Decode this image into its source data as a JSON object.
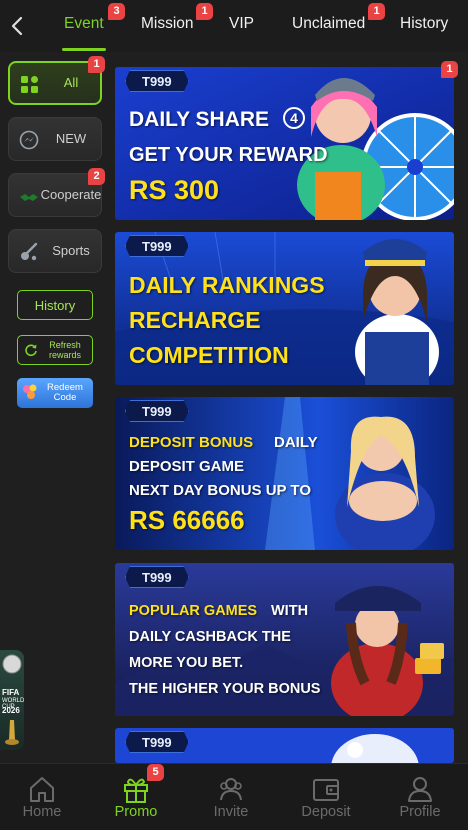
{
  "header": {
    "tabs": [
      {
        "label": "Event",
        "badge": "3"
      },
      {
        "label": "Mission",
        "badge": "1"
      },
      {
        "label": "VIP",
        "badge": ""
      },
      {
        "label": "Unclaimed",
        "badge": "1"
      },
      {
        "label": "History",
        "badge": ""
      }
    ]
  },
  "sidebar": {
    "categories": [
      {
        "label": "All",
        "badge": "1",
        "icon": "grid-icon"
      },
      {
        "label": "NEW",
        "badge": "",
        "icon": "messenger-icon"
      },
      {
        "label": "Cooperate",
        "badge": "2",
        "icon": "handshake-icon"
      },
      {
        "label": "Sports",
        "badge": "",
        "icon": "sports-icon"
      }
    ],
    "history_label": "History",
    "refresh_label": "Refresh rewards",
    "redeem_label": "Redeem Code"
  },
  "fifa": {
    "line1": "FIFA",
    "line2": "WORLD CUP",
    "line3": "2026"
  },
  "banners": [
    {
      "tag": "T999",
      "badge": "1",
      "lines": [
        "DAILY SHARE",
        "4",
        "GET YOUR REWARD",
        "RS 300"
      ]
    },
    {
      "tag": "T999",
      "lines": [
        "DAILY RANKINGS",
        "RECHARGE",
        "COMPETITION"
      ]
    },
    {
      "tag": "T999",
      "lines": [
        "DEPOSIT BONUS",
        "DAILY",
        "DEPOSIT GAME",
        "NEXT DAY BONUS UP TO",
        "RS 66666"
      ]
    },
    {
      "tag": "T999",
      "lines": [
        "POPULAR GAMES",
        "WITH",
        "DAILY CASHBACK THE",
        "MORE YOU BET.",
        "THE HIGHER YOUR BONUS"
      ]
    },
    {
      "tag": "T999",
      "lines": []
    }
  ],
  "bottom_nav": {
    "items": [
      {
        "label": "Home",
        "badge": ""
      },
      {
        "label": "Promo",
        "badge": "5"
      },
      {
        "label": "Invite",
        "badge": ""
      },
      {
        "label": "Deposit",
        "badge": ""
      },
      {
        "label": "Profile",
        "badge": ""
      }
    ]
  },
  "colors": {
    "accent": "#7ed321",
    "badge": "#e94343",
    "background": "#1f1f1f",
    "banner_yellow": "#ffe11a"
  }
}
